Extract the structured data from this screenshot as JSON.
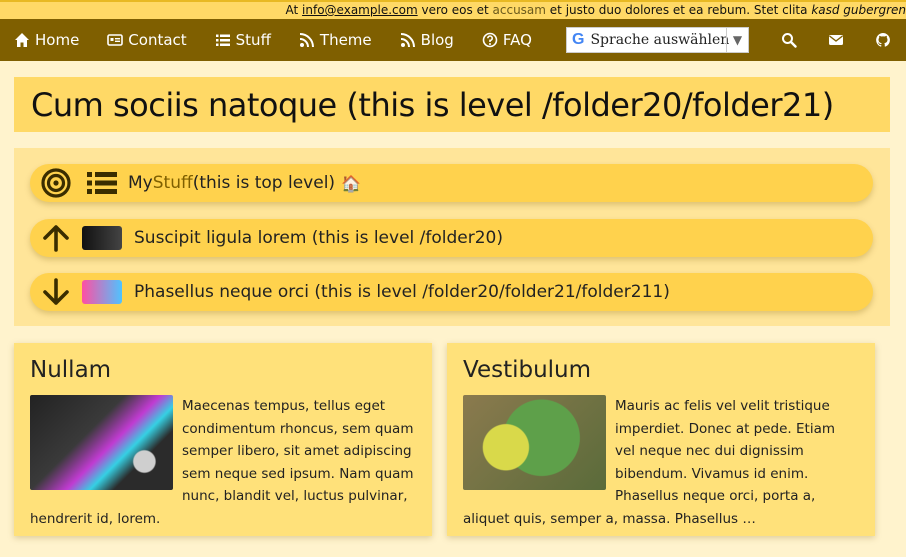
{
  "topbar": {
    "pre": "At",
    "email": "info@example.com",
    "mid": "vero eos et",
    "muted": "accusam",
    "post": "et justo duo dolores et ea rebum. Stet clita",
    "em": "kasd gubergren"
  },
  "nav": {
    "items": [
      {
        "label": "Home",
        "icon": "home-icon"
      },
      {
        "label": "Contact",
        "icon": "id-card-icon"
      },
      {
        "label": "Stuff",
        "icon": "list-icon"
      },
      {
        "label": "Theme",
        "icon": "rss-icon"
      },
      {
        "label": "Blog",
        "icon": "rss-icon"
      },
      {
        "label": "FAQ",
        "icon": "question-icon"
      }
    ],
    "translate_label": "Sprache auswählen",
    "translate_logo": "G",
    "right_icons": [
      "search-icon",
      "envelope-icon",
      "github-icon"
    ]
  },
  "page": {
    "title": "Cum sociis natoque (this is level /folder20/folder21)"
  },
  "breadcrumbs": [
    {
      "text_pre": "My ",
      "text_link": "Stuff",
      "text_post": " (this is top level)",
      "lead_icon": "bullseye-icon",
      "thumb_icon": "list-icon",
      "home_glyph": "🏠"
    },
    {
      "text": "Suscipit ligula lorem (this is level /folder20)",
      "lead_icon": "arrow-up-icon",
      "thumb_icon": "signature-thumbnail"
    },
    {
      "text": "Phasellus neque orci (this is level /folder20/folder21/folder211)",
      "lead_icon": "arrow-down-icon",
      "thumb_icon": "gohugo-thumbnail"
    }
  ],
  "cards": [
    {
      "title": "Nullam",
      "image": "monitor-image",
      "text": "Maecenas tempus, tellus eget condimentum rhoncus, sem quam semper libero, sit amet adipiscing sem neque sed ipsum. Nam quam nunc, blandit vel, luctus pulvinar, hendrerit id, lorem."
    },
    {
      "title": "Vestibulum",
      "image": "parrot-image",
      "text": "Mauris ac felis vel velit tristique imperdiet. Donec at pede. Etiam vel neque nec dui dignissim bibendum. Vivamus id enim. Phasellus neque orci, porta a, aliquet quis, semper a, massa. Phasellus …"
    }
  ],
  "colors": {
    "nav_bg": "#7f5f00",
    "accent": "#ffd966",
    "crumb": "#ffd24d",
    "page_bg": "#fff3cd"
  }
}
